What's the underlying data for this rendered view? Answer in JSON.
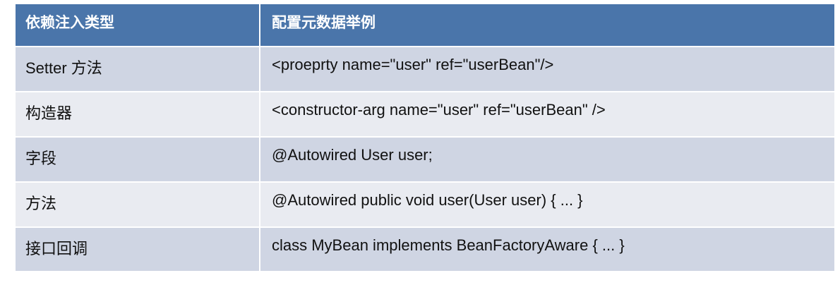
{
  "table": {
    "headers": [
      "依赖注入类型",
      "配置元数据举例"
    ],
    "rows": [
      [
        "Setter 方法",
        "<proeprty name=\"user\" ref=\"userBean\"/>"
      ],
      [
        "构造器",
        "<constructor-arg name=\"user\" ref=\"userBean\" />"
      ],
      [
        "字段",
        "@Autowired User user;"
      ],
      [
        "方法",
        "@Autowired public void user(User user) { ... }"
      ],
      [
        "接口回调",
        "class MyBean implements BeanFactoryAware { ... }"
      ]
    ]
  },
  "colors": {
    "header_bg": "#4a75aa",
    "row_dark": "#cfd5e3",
    "row_light": "#e9ebf1"
  }
}
